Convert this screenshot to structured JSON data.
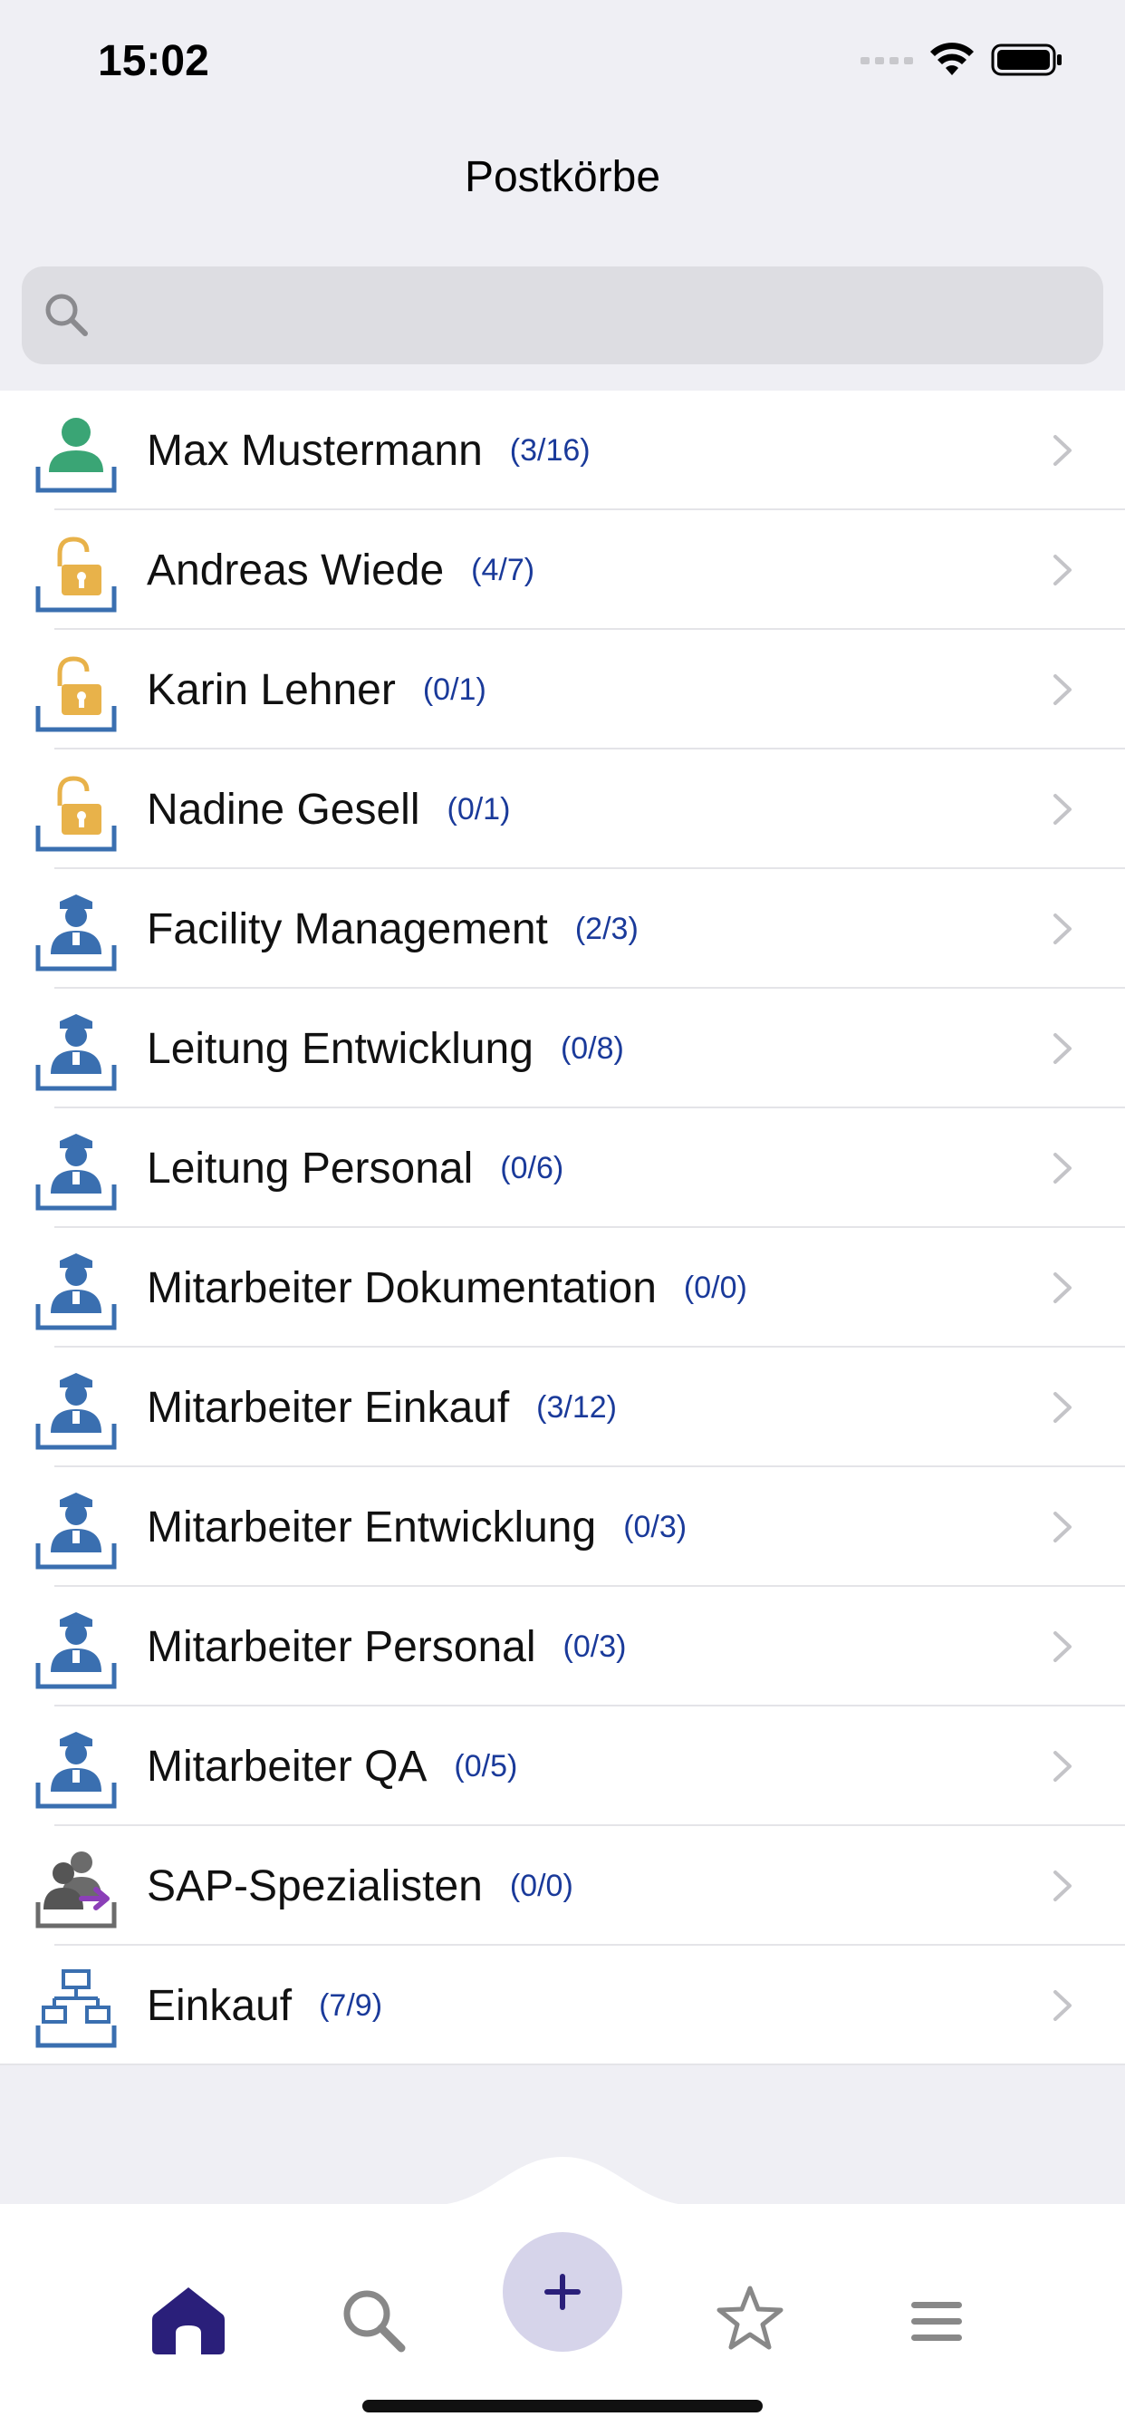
{
  "status": {
    "time": "15:02"
  },
  "nav": {
    "title": "Postkörbe"
  },
  "search": {
    "placeholder": "",
    "value": ""
  },
  "colors": {
    "accent": "#2a1f7a",
    "count": "#1a3a9a",
    "user": "#3aa575",
    "lock": "#e8b24a",
    "group": "#3a6fb0",
    "plus_bg": "#d6d4ea"
  },
  "mailboxes": [
    {
      "name": "Max Mustermann",
      "count": "(3/16)",
      "icon": "user-inbox-icon"
    },
    {
      "name": "Andreas Wiede",
      "count": "(4/7)",
      "icon": "unlocked-inbox-icon"
    },
    {
      "name": "Karin Lehner",
      "count": "(0/1)",
      "icon": "unlocked-inbox-icon"
    },
    {
      "name": "Nadine Gesell",
      "count": "(0/1)",
      "icon": "unlocked-inbox-icon"
    },
    {
      "name": "Facility Management",
      "count": "(2/3)",
      "icon": "role-inbox-icon"
    },
    {
      "name": "Leitung Entwicklung",
      "count": "(0/8)",
      "icon": "role-inbox-icon"
    },
    {
      "name": "Leitung Personal",
      "count": "(0/6)",
      "icon": "role-inbox-icon"
    },
    {
      "name": "Mitarbeiter Dokumentation",
      "count": "(0/0)",
      "icon": "role-inbox-icon"
    },
    {
      "name": "Mitarbeiter Einkauf",
      "count": "(3/12)",
      "icon": "role-inbox-icon"
    },
    {
      "name": "Mitarbeiter Entwicklung",
      "count": "(0/3)",
      "icon": "role-inbox-icon"
    },
    {
      "name": "Mitarbeiter Personal",
      "count": "(0/3)",
      "icon": "role-inbox-icon"
    },
    {
      "name": "Mitarbeiter QA",
      "count": "(0/5)",
      "icon": "role-inbox-icon"
    },
    {
      "name": "SAP-Spezialisten",
      "count": "(0/0)",
      "icon": "group-forward-inbox-icon"
    },
    {
      "name": "Einkauf",
      "count": "(7/9)",
      "icon": "org-inbox-icon"
    }
  ],
  "tabs": [
    {
      "icon": "home-icon"
    },
    {
      "icon": "search-icon"
    },
    {
      "icon": "plus-icon"
    },
    {
      "icon": "star-icon"
    },
    {
      "icon": "menu-icon"
    }
  ]
}
